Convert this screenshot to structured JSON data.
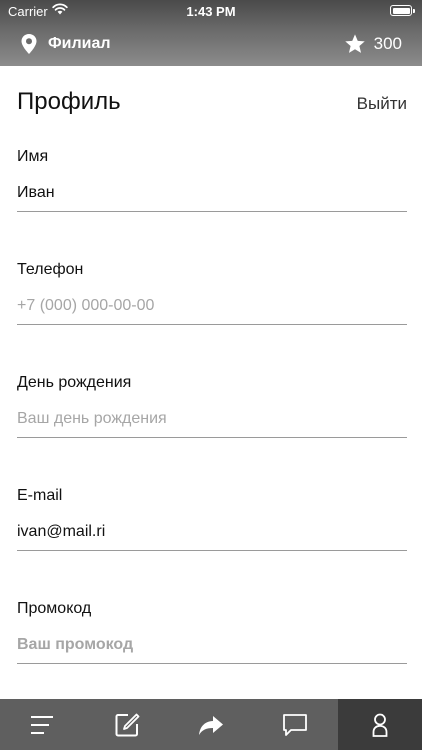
{
  "status_bar": {
    "carrier": "Carrier",
    "time": "1:43 PM"
  },
  "header": {
    "branch": "Филиал",
    "points": "300"
  },
  "page": {
    "title": "Профиль",
    "logout": "Выйти"
  },
  "fields": [
    {
      "label": "Имя",
      "value": "Иван",
      "placeholder": ""
    },
    {
      "label": "Телефон",
      "value": "",
      "placeholder": "+7 (000) 000-00-00"
    },
    {
      "label": "День рождения",
      "value": "",
      "placeholder": "Ваш день рождения"
    },
    {
      "label": "E-mail",
      "value": "ivan@mail.ri",
      "placeholder": ""
    },
    {
      "label": "Промокод",
      "value": "",
      "placeholder": "Ваш промокод"
    }
  ],
  "tabbar": {
    "tabs": [
      {
        "icon": "menu-icon",
        "active": false
      },
      {
        "icon": "edit-icon",
        "active": false
      },
      {
        "icon": "share-icon",
        "active": false
      },
      {
        "icon": "chat-icon",
        "active": false
      },
      {
        "icon": "profile-icon",
        "active": true
      }
    ]
  },
  "colors": {
    "tabbar": "#5f5f5f",
    "tab_active": "#3b3b3b",
    "divider": "#9a9a9a",
    "placeholder": "#a6a6a6"
  }
}
